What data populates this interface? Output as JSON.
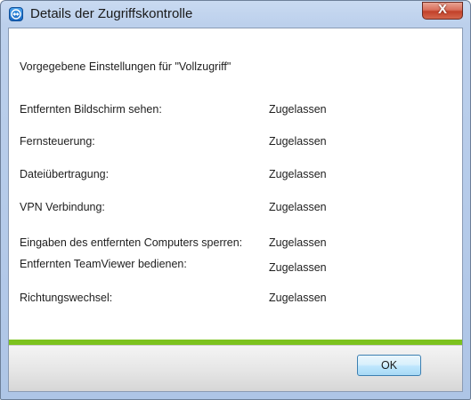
{
  "window": {
    "title": "Details der Zugriffskontrolle",
    "close_label": "X"
  },
  "content": {
    "heading": "Vorgegebene Einstellungen für \"Vollzugriff\"",
    "rows": [
      {
        "label": "Entfernten Bildschirm sehen:",
        "value": "Zugelassen"
      },
      {
        "label": "Fernsteuerung:",
        "value": "Zugelassen"
      },
      {
        "label": "Dateiübertragung:",
        "value": "Zugelassen"
      },
      {
        "label": "VPN Verbindung:",
        "value": "Zugelassen"
      },
      {
        "label": "Eingaben des entfernten Computers sperren:",
        "value": "Zugelassen"
      },
      {
        "label": "Entfernten TeamViewer bedienen:",
        "value": "Zugelassen"
      },
      {
        "label": "Richtungswechsel:",
        "value": "Zugelassen"
      }
    ]
  },
  "footer": {
    "ok_label": "OK"
  },
  "colors": {
    "accent_bar": "#7cc21e",
    "close_button": "#c2412a",
    "app_icon": "#1565c0"
  }
}
